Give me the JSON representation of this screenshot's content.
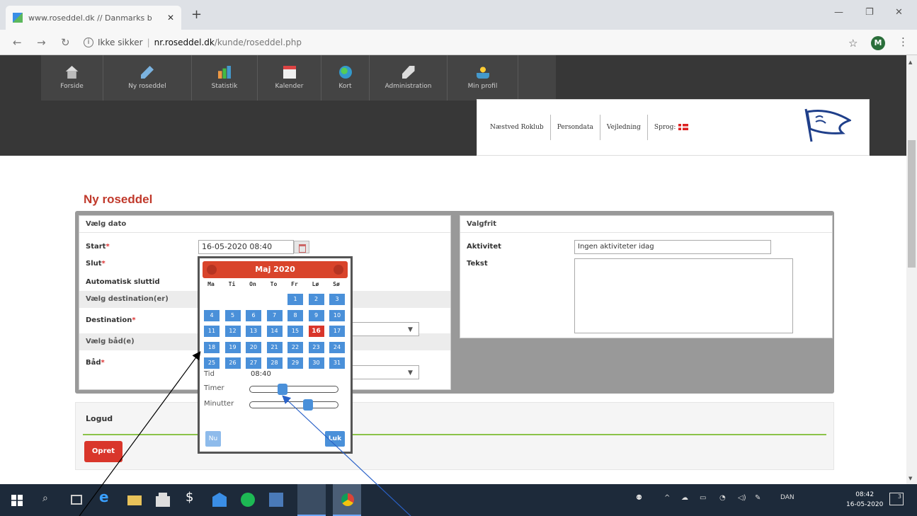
{
  "browser": {
    "tab_title": "www.roseddel.dk // Danmarks b",
    "tab_close": "✕",
    "new_tab": "+",
    "address_security": "Ikke sikker",
    "address_host": "nr.roseddel.dk",
    "address_path": "/kunde/roseddel.php",
    "profile_initial": "M"
  },
  "nav": {
    "items": [
      {
        "label": "Forside",
        "icon": "house-icon"
      },
      {
        "label": "Ny roseddel",
        "icon": "pencil-icon"
      },
      {
        "label": "Statistik",
        "icon": "chart-icon"
      },
      {
        "label": "Kalender",
        "icon": "calendar-icon"
      },
      {
        "label": "Kort",
        "icon": "globe-icon"
      },
      {
        "label": "Administration",
        "icon": "wrench-icon"
      },
      {
        "label": "Min profil",
        "icon": "user-icon"
      }
    ]
  },
  "club": {
    "name": "Næstved Roklub",
    "persondata": "Persondata",
    "vejledning": "Vejledning",
    "sprog": "Sprog:"
  },
  "form": {
    "page_title": "Ny roseddel",
    "left_header": "Vælg dato",
    "start_label": "Start",
    "start_value": "16-05-2020 08:40",
    "slut_label": "Slut",
    "auto_label": "Automatisk sluttid",
    "dest_section": "Vælg destination(er)",
    "dest_label": "Destination",
    "boat_section": "Vælg båd(e)",
    "boat_label": "Båd",
    "required_mark": "*",
    "right_header": "Valgfrit",
    "activity_label": "Aktivitet",
    "activity_value": "Ingen aktiviteter idag",
    "text_label": "Tekst"
  },
  "logud": {
    "label": "Logud",
    "button": "Opret"
  },
  "datepicker": {
    "month_title": "Maj 2020",
    "weekdays": [
      "Ma",
      "Ti",
      "On",
      "To",
      "Fr",
      "Lø",
      "Sø"
    ],
    "selected_day": 16,
    "time_label": "Tid",
    "time_value": "08:40",
    "hours_label": "Timer",
    "minutes_label": "Minutter",
    "hours_fraction": 0.35,
    "minutes_fraction": 0.67,
    "now_button": "Nu",
    "close_button": "Luk"
  },
  "taskbar": {
    "language": "DAN",
    "time": "08:42",
    "date": "16-05-2020",
    "notification_count": "3"
  },
  "colors": {
    "accent_red": "#d9362b",
    "calendar_blue": "#4a90d9",
    "header_dark": "#373737"
  }
}
